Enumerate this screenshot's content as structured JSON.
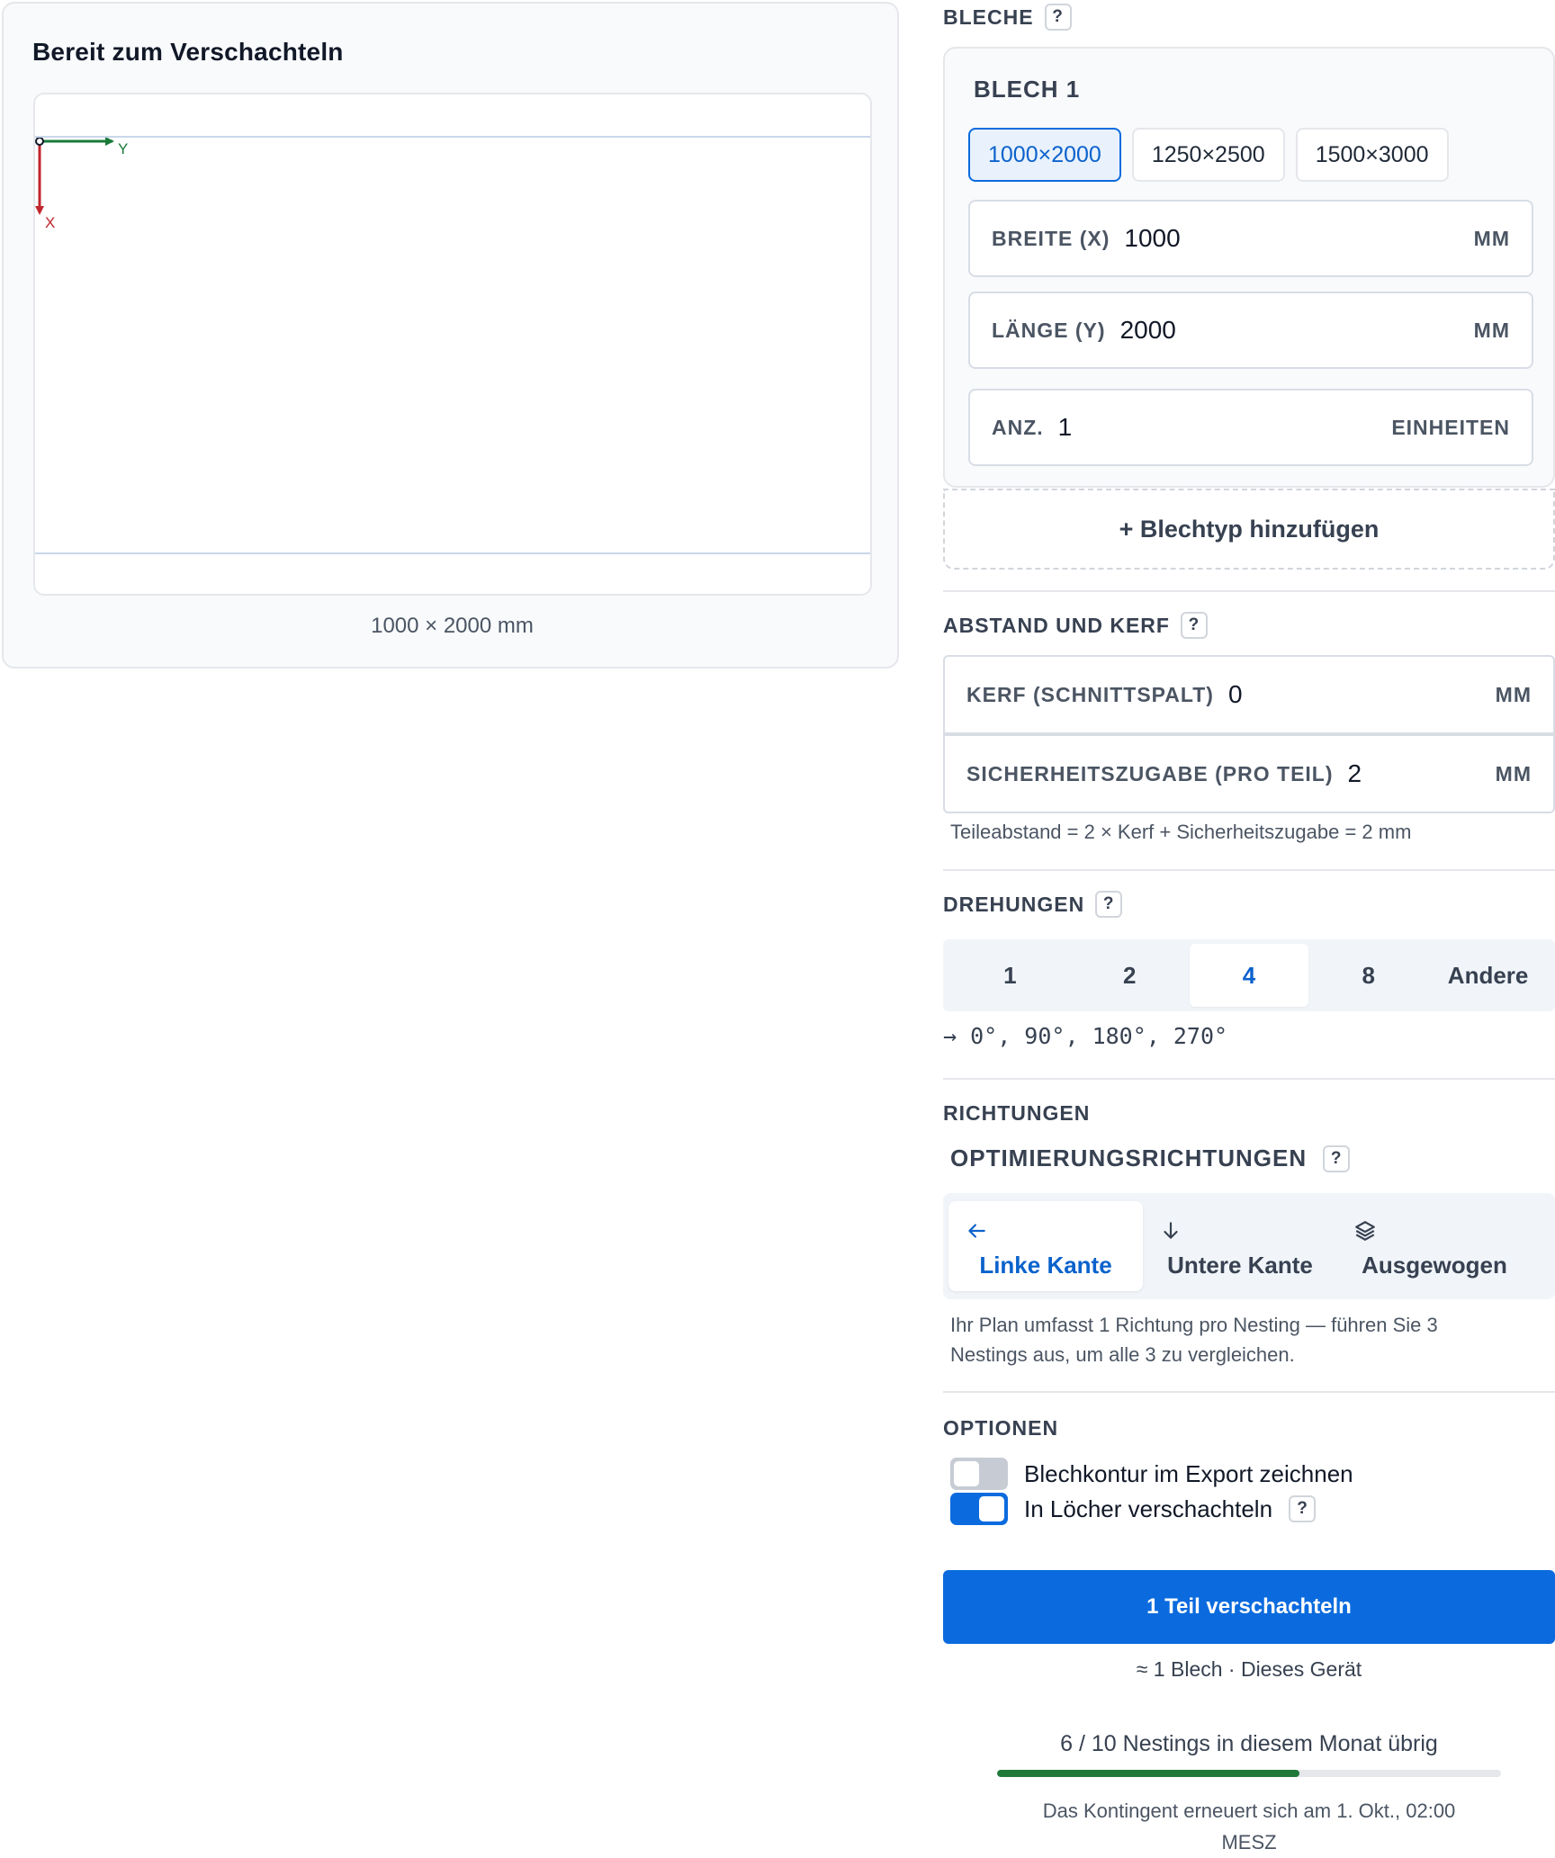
{
  "preview": {
    "title": "Bereit zum Verschachteln",
    "axis_x": "X",
    "axis_y": "Y",
    "sheet_size": "1000 × 2000 mm"
  },
  "sheets": {
    "section_title": "BLECHE",
    "help": "?",
    "card_title": "BLECH 1",
    "presets": [
      "1000×2000",
      "1250×2500",
      "1500×3000"
    ],
    "active_preset": 0,
    "width_label": "BREITE (X)",
    "width_value": "1000",
    "width_unit": "MM",
    "length_label": "LÄNGE (Y)",
    "length_value": "2000",
    "length_unit": "MM",
    "qty_label": "ANZ.",
    "qty_value": "1",
    "qty_unit": "EINHEITEN",
    "add_type": "+ Blechtyp hinzufügen"
  },
  "spacing": {
    "section_title": "ABSTAND UND KERF",
    "kerf_label": "KERF (SCHNITTSPALT)",
    "kerf_value": "0",
    "kerf_unit": "MM",
    "margin_label": "SICHERHEITSZUGABE (PRO TEIL)",
    "margin_value": "2",
    "margin_unit": "MM",
    "formula": "Teileabstand = 2 × Kerf + Sicherheitszugabe = 2 mm"
  },
  "rotations": {
    "section_title": "DREHUNGEN",
    "options": [
      "1",
      "2",
      "4",
      "8",
      "Andere"
    ],
    "active": 2,
    "angles": "→ 0°, 90°, 180°, 270°"
  },
  "directions": {
    "section_title": "RICHTUNGEN",
    "subtitle": "OPTIMIERUNGSRICHTUNGEN",
    "options": [
      {
        "label": "Linke Kante",
        "icon": "arrow-left-icon"
      },
      {
        "label": "Untere Kante",
        "icon": "arrow-down-icon"
      },
      {
        "label": "Ausgewogen",
        "icon": "layers-icon"
      }
    ],
    "active": 0,
    "hint_line1": "Ihr Plan umfasst 1 Richtung pro Nesting — führen Sie 3",
    "hint_line2": "Nestings aus, um alle 3 zu vergleichen."
  },
  "options": {
    "section_title": "OPTIONEN",
    "draw_outline_label": "Blechkontur im Export zeichnen",
    "draw_outline_on": false,
    "nest_holes_label": "In Löcher verschachteln",
    "nest_holes_on": true
  },
  "action": {
    "button_label": "1 Teil verschachteln",
    "estimate": "≈ 1 Blech · Dieses Gerät"
  },
  "quota": {
    "text": "6 / 10 Nestings in diesem Monat übrig",
    "used_fraction": 0.6,
    "renew_line1": "Das Kontingent erneuert sich am 1. Okt., 02:00",
    "renew_line2": "MESZ"
  },
  "colors": {
    "accent": "#0b6bde",
    "axis_x": "#c0262d",
    "axis_y": "#1a7a3a",
    "quota_fill": "#1f7a3a"
  }
}
